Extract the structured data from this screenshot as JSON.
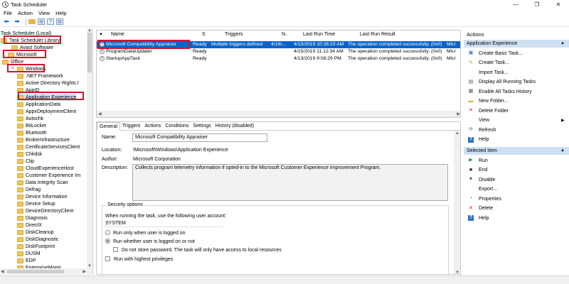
{
  "window": {
    "title": "Task Scheduler",
    "minimize": "—",
    "maximize": "❐",
    "close": "✕"
  },
  "menu": [
    "File",
    "Action",
    "View",
    "Help"
  ],
  "tree": {
    "items": [
      {
        "label": "Task Scheduler (Local)",
        "indent": 0
      },
      {
        "label": "Task Scheduler Library",
        "indent": 0
      },
      {
        "label": "Avast Software",
        "indent": 2
      },
      {
        "label": "Microsoft",
        "indent": 1
      },
      {
        "label": "Office",
        "indent": 3
      },
      {
        "label": "Windows",
        "indent": 2
      },
      {
        "label": ".NET Framework",
        "indent": 4
      },
      {
        "label": "Active Directory Rights I",
        "indent": 4
      },
      {
        "label": "AppID",
        "indent": 4
      },
      {
        "label": "Application Experience",
        "indent": 4
      },
      {
        "label": "ApplicationData",
        "indent": 4
      },
      {
        "label": "AppxDeploymentClient",
        "indent": 4
      },
      {
        "label": "Autochk",
        "indent": 4
      },
      {
        "label": "BitLocker",
        "indent": 4
      },
      {
        "label": "Bluetooth",
        "indent": 4
      },
      {
        "label": "BrokerInfrastructure",
        "indent": 4
      },
      {
        "label": "CertificateServicesClient",
        "indent": 4
      },
      {
        "label": "Chkdsk",
        "indent": 4
      },
      {
        "label": "Clip",
        "indent": 4
      },
      {
        "label": "CloudExperienceHost",
        "indent": 4
      },
      {
        "label": "Customer Experience Im",
        "indent": 4
      },
      {
        "label": "Data Integrity Scan",
        "indent": 4
      },
      {
        "label": "Defrag",
        "indent": 4
      },
      {
        "label": "Device Information",
        "indent": 4
      },
      {
        "label": "Device Setup",
        "indent": 4
      },
      {
        "label": "DeviceDirectoryClient",
        "indent": 4
      },
      {
        "label": "Diagnosis",
        "indent": 4
      },
      {
        "label": "DirectX",
        "indent": 4
      },
      {
        "label": "DiskCleanup",
        "indent": 4
      },
      {
        "label": "DiskDiagnostic",
        "indent": 4
      },
      {
        "label": "DiskFootprint",
        "indent": 4
      },
      {
        "label": "DUSM",
        "indent": 4
      },
      {
        "label": "EDP",
        "indent": 4
      },
      {
        "label": "EnterpriseMgmt",
        "indent": 4
      }
    ]
  },
  "tasklist": {
    "columns": [
      "Name",
      "S",
      "Triggers",
      "N..",
      "Last Run Time",
      "Last Run Result"
    ],
    "rows": [
      {
        "name": "Microsoft Compatibility Appraiser",
        "status": "Ready",
        "triggers": "Multiple triggers defined",
        "next": "4/16/...",
        "last_run": "4/15/2019 10:26:23 AM",
        "result": "The operation completed successfully. (0x0)",
        "author": "Micr"
      },
      {
        "name": "ProgramDataUpdater",
        "status": "Ready",
        "triggers": "",
        "next": "",
        "last_run": "4/15/2019 11:12:34 AM",
        "result": "The operation completed successfully. (0x0)",
        "author": "Micr"
      },
      {
        "name": "StartupAppTask",
        "status": "Ready",
        "triggers": "",
        "next": "",
        "last_run": "4/13/2019 9:08:29 PM",
        "result": "The operation completed successfully. (0x0)",
        "author": "Micr"
      }
    ]
  },
  "detail": {
    "tabs": [
      "General",
      "Triggers",
      "Actions",
      "Conditions",
      "Settings",
      "History (disabled)"
    ],
    "name_label": "Name:",
    "name_value": "Microsoft Compatibility Appraiser",
    "location_label": "Location:",
    "location_value": "\\Microsoft\\Windows\\Application Experience",
    "author_label": "Author:",
    "author_value": "Microsoft Corporation",
    "description_label": "Description:",
    "description_value": "Collects program telemetry information if opted-in to the Microsoft Customer Experience Improvement Program.",
    "security_title": "Security options",
    "security_account_label": "When running the task, use the following user account:",
    "security_account": "SYSTEM",
    "radio_logged_on": "Run only when user is logged on",
    "radio_logged_or_not": "Run whether user is logged on or not",
    "check_no_password": "Do not store password.  The task will only have access to local resources",
    "check_highest": "Run with highest privileges"
  },
  "actions": {
    "header": "Actions",
    "group1_title": "Application Experience",
    "group1": [
      {
        "label": "Create Basic Task...",
        "icon": "create-basic-task-icon"
      },
      {
        "label": "Create Task...",
        "icon": "create-task-icon"
      },
      {
        "label": "Import Task...",
        "icon": "import-icon"
      },
      {
        "label": "Display All Running Tasks",
        "icon": "running-tasks-icon"
      },
      {
        "label": "Enable All Tasks History",
        "icon": "history-icon"
      },
      {
        "label": "New Folder...",
        "icon": "new-folder-icon"
      },
      {
        "label": "Delete Folder",
        "icon": "delete-icon"
      },
      {
        "label": "View",
        "icon": "view-icon"
      },
      {
        "label": "Refresh",
        "icon": "refresh-icon"
      },
      {
        "label": "Help",
        "icon": "help-icon"
      }
    ],
    "group2_title": "Selected Item",
    "group2": [
      {
        "label": "Run",
        "icon": "run-icon"
      },
      {
        "label": "End",
        "icon": "end-icon"
      },
      {
        "label": "Disable",
        "icon": "disable-icon"
      },
      {
        "label": "Export...",
        "icon": "export-icon"
      },
      {
        "label": "Properties",
        "icon": "properties-icon"
      },
      {
        "label": "Delete",
        "icon": "delete-icon"
      },
      {
        "label": "Help",
        "icon": "help-icon"
      }
    ]
  },
  "colors": {
    "selection": "#0a64c8",
    "highlight_box": "#d0162e",
    "action_group_bg": "#cfe0f3"
  }
}
